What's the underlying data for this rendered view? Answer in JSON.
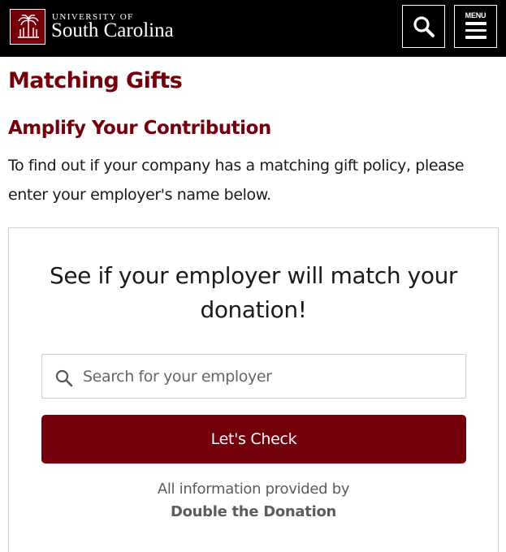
{
  "header": {
    "brand_top": "UNIVERSITY OF",
    "brand_main": "South Carolina",
    "menu_label": "MENU",
    "search_icon": "search-icon",
    "menu_icon": "hamburger-icon",
    "logo_icon": "palmetto-tree-logo",
    "colors": {
      "bar": "#000000",
      "garnet": "#73000a"
    }
  },
  "main": {
    "title": "Matching Gifts",
    "subheading": "Amplify Your Contribution",
    "intro": "To find out if your company has a matching gift policy, please enter your employer's name below."
  },
  "widget": {
    "heading": "See if your employer will match your donation!",
    "search_placeholder": "Search for your employer",
    "search_value": "",
    "button_label": "Let's Check",
    "provided_by": "All information provided by",
    "provider": "Double the Donation"
  }
}
